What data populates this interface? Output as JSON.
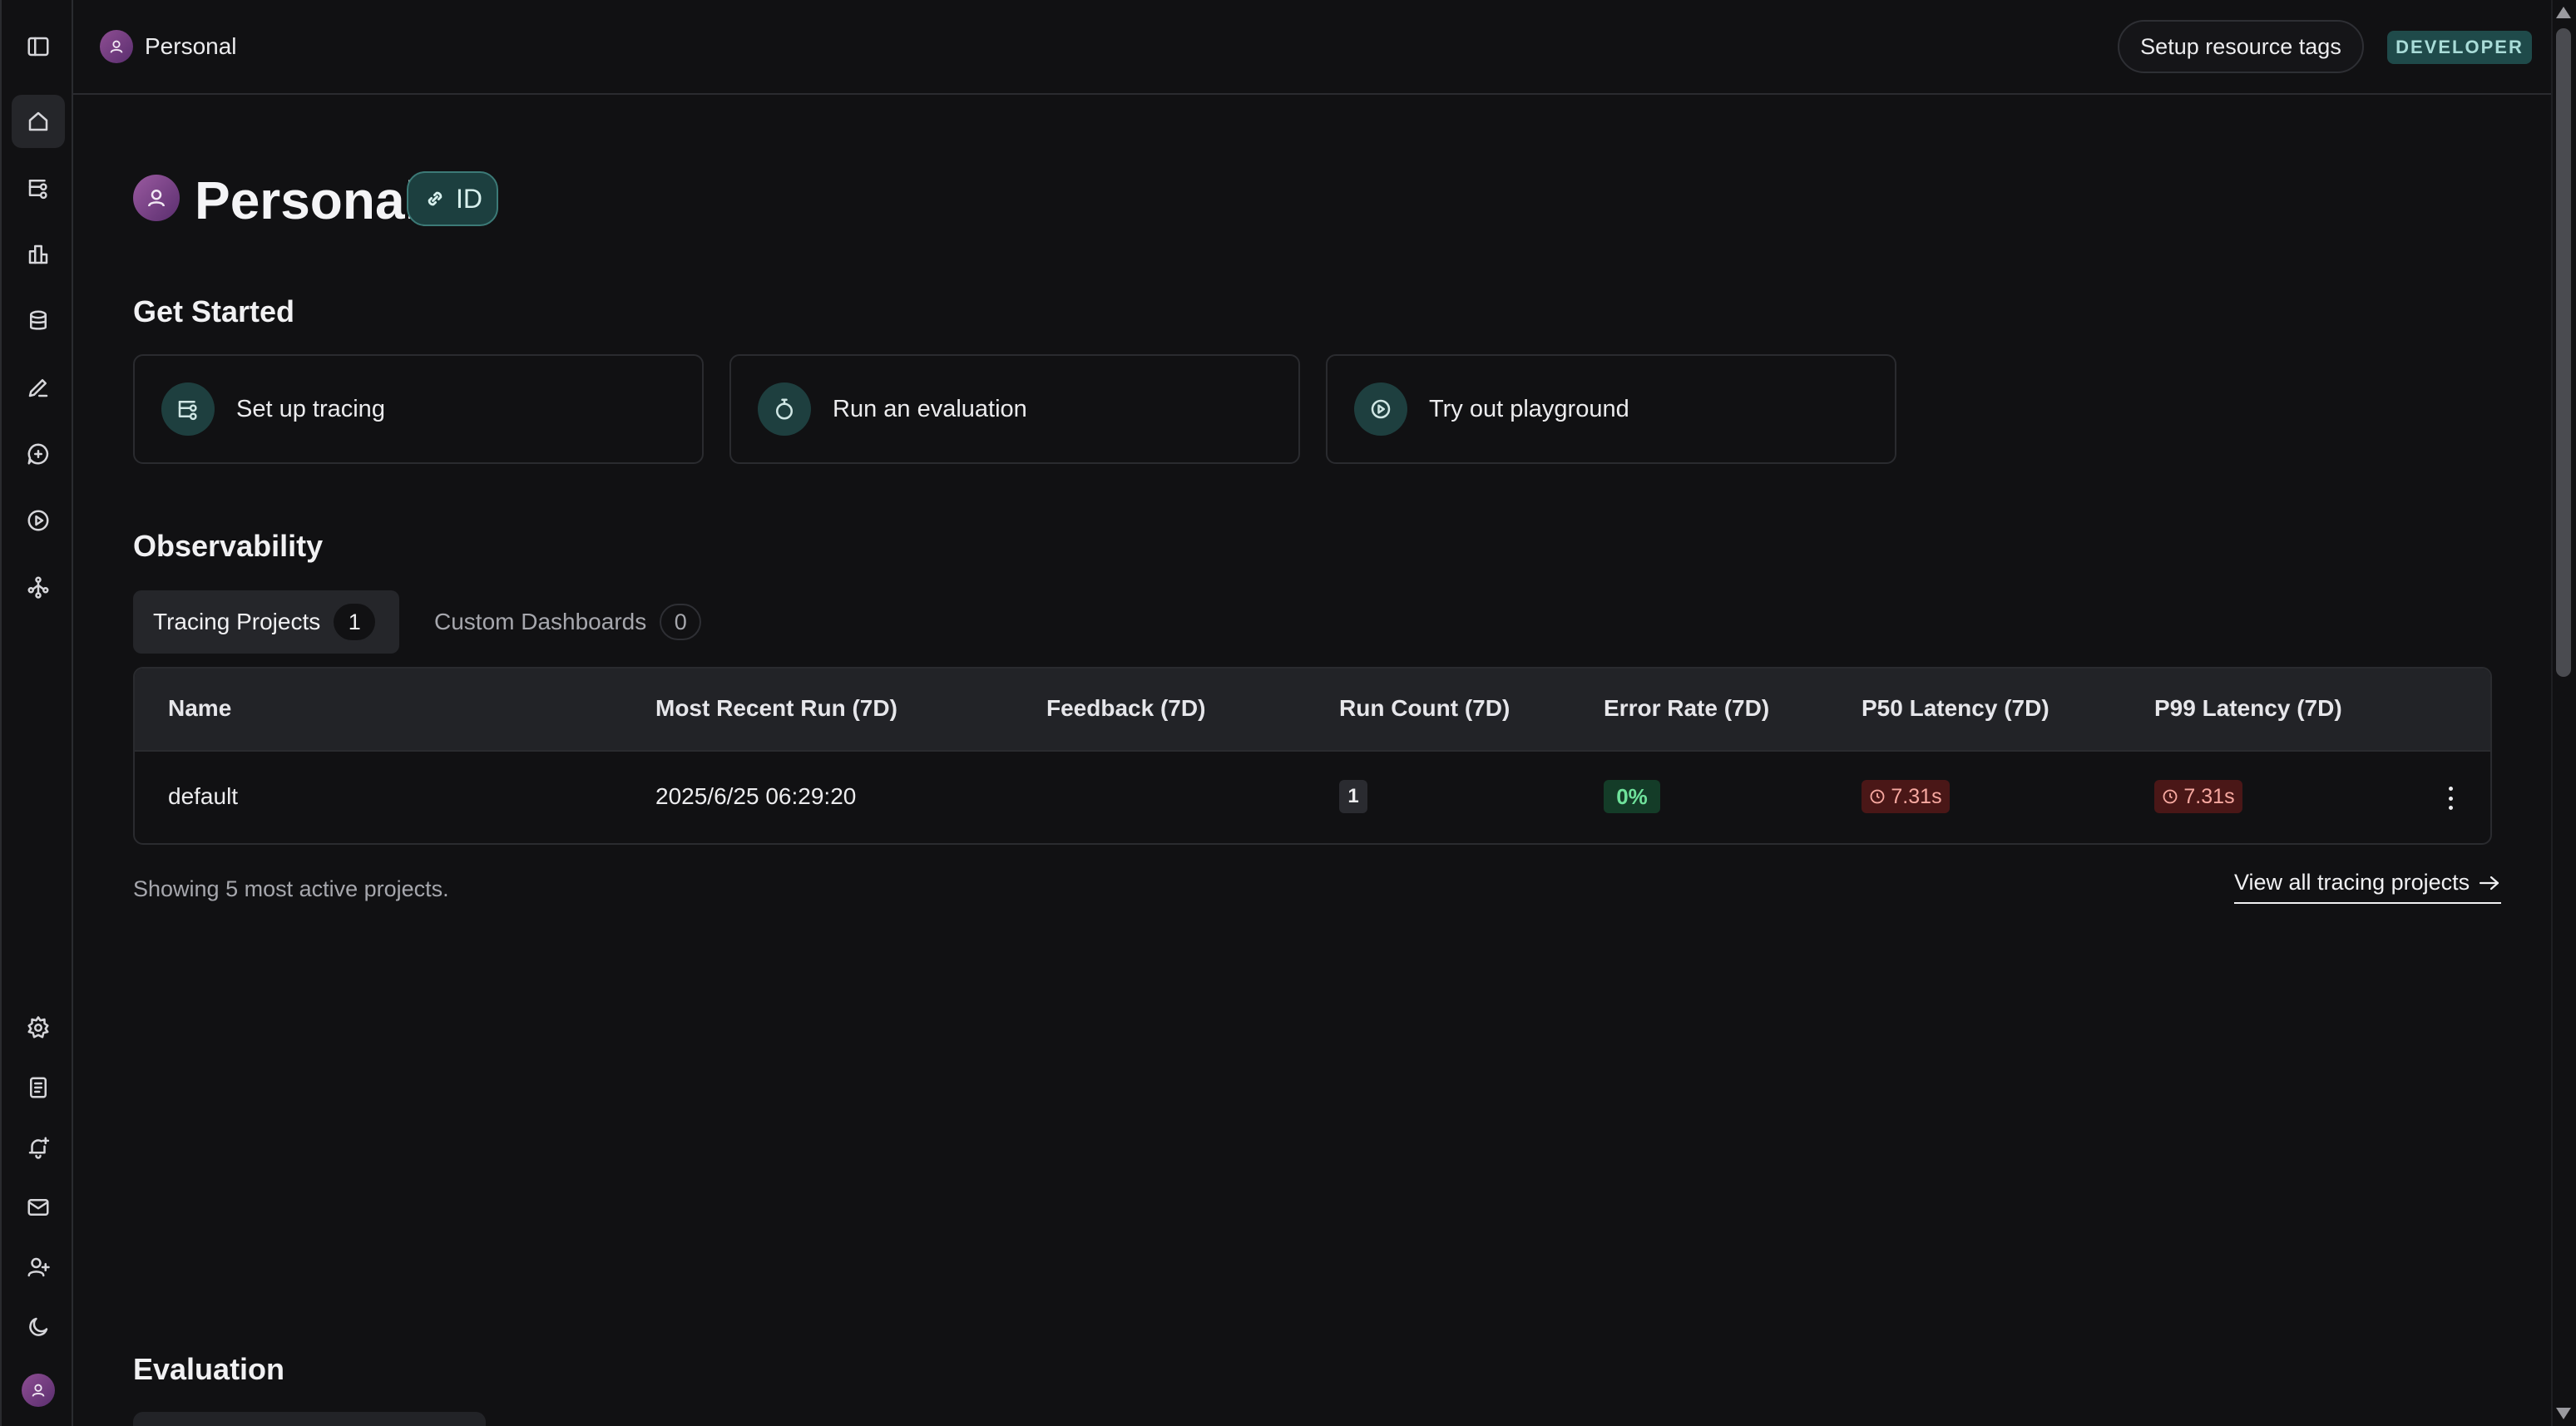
{
  "topbar": {
    "workspace_name": "Personal",
    "setup_tags_label": "Setup resource tags",
    "badge": "DEVELOPER"
  },
  "rail": {
    "top_icons": [
      "sidebar-toggle-icon",
      "home-icon",
      "tracing-icon",
      "dashboards-icon",
      "datasets-icon",
      "annotation-icon",
      "prompts-icon",
      "playground-icon",
      "deployments-icon"
    ],
    "bottom_icons": [
      "settings-icon",
      "docs-icon",
      "alerts-icon",
      "mail-icon",
      "add-user-icon",
      "dark-mode-icon"
    ]
  },
  "header": {
    "title": "Personal",
    "id_label": "ID"
  },
  "get_started": {
    "heading": "Get Started",
    "cards": [
      {
        "label": "Set up tracing",
        "icon": "tracing-icon"
      },
      {
        "label": "Run an evaluation",
        "icon": "stopwatch-icon"
      },
      {
        "label": "Try out playground",
        "icon": "play-circle-icon"
      }
    ]
  },
  "observability": {
    "heading": "Observability",
    "tabs": [
      {
        "label": "Tracing Projects",
        "count": "1"
      },
      {
        "label": "Custom Dashboards",
        "count": "0"
      }
    ],
    "columns": [
      "Name",
      "Most Recent Run (7D)",
      "Feedback (7D)",
      "Run Count (7D)",
      "Error Rate (7D)",
      "P50 Latency (7D)",
      "P99 Latency (7D)"
    ],
    "rows": [
      {
        "name": "default",
        "most_recent_run": "2025/6/25 06:29:20",
        "feedback": "",
        "run_count": "1",
        "error_rate": "0%",
        "p50": "7.31s",
        "p99": "7.31s"
      }
    ],
    "footer_note": "Showing 5 most active projects.",
    "view_all_label": "View all tracing projects"
  },
  "evaluation": {
    "heading": "Evaluation"
  },
  "colors": {
    "background": "#111113",
    "accent_teal": "#1F4A4A",
    "error_green": "#6FE29B",
    "latency_red": "#F7A8A0"
  }
}
